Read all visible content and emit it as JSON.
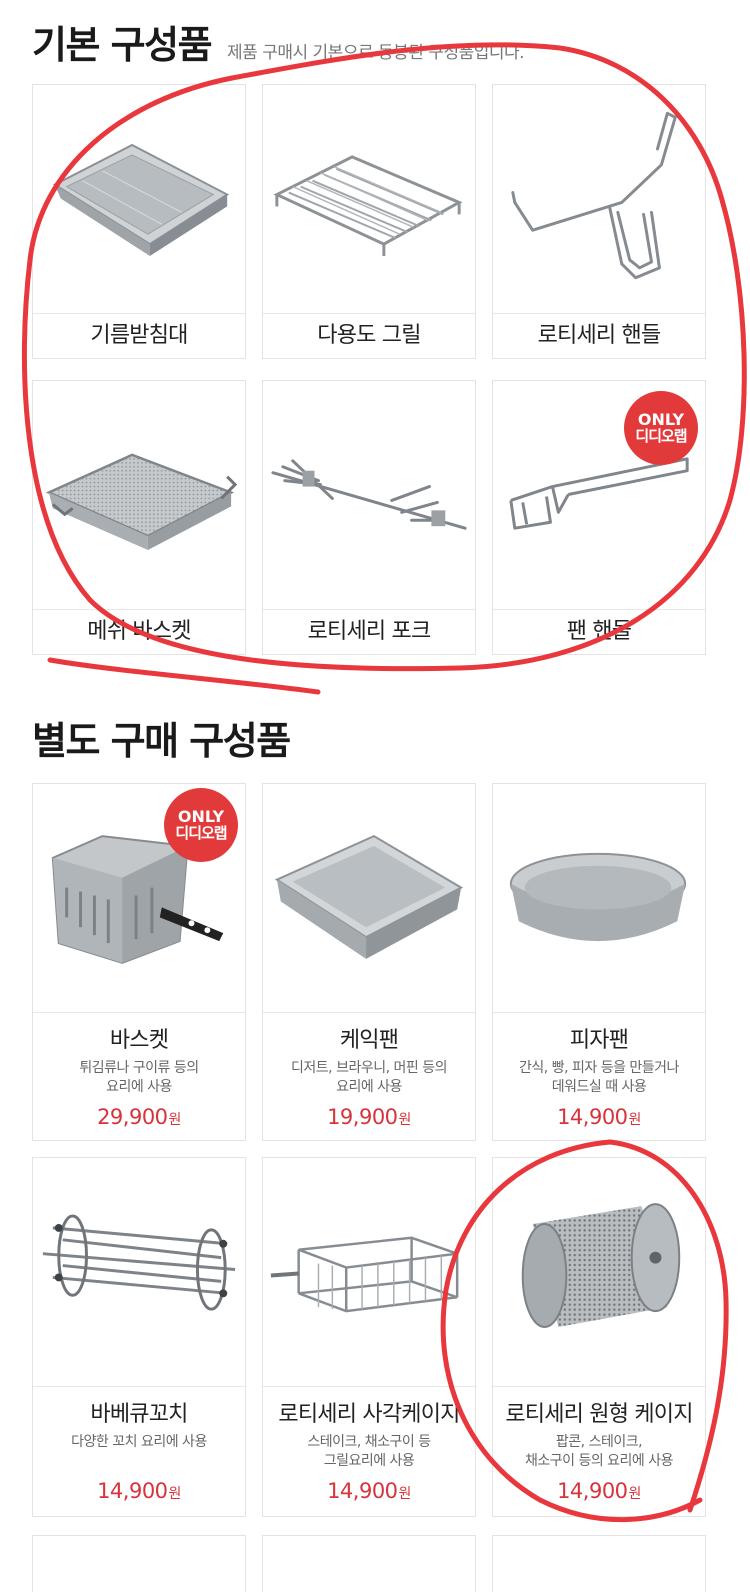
{
  "basic_section": {
    "title": "기본 구성품",
    "subtitle": "제품 구매시 기본으로 동봉된 구성품입니다.",
    "items": [
      {
        "label": "기름받침대",
        "icon": "drip-tray-icon"
      },
      {
        "label": "다용도 그릴",
        "icon": "wire-grill-icon"
      },
      {
        "label": "로티세리 핸들",
        "icon": "rotisserie-handle-icon"
      },
      {
        "label": "메쉬 바스켓",
        "icon": "mesh-basket-icon"
      },
      {
        "label": "로티세리 포크",
        "icon": "rotisserie-fork-icon"
      },
      {
        "label": "팬 핸들",
        "icon": "pan-handle-icon",
        "badge": {
          "line1": "ONLY",
          "line2": "디디오랩"
        }
      }
    ]
  },
  "option_section": {
    "title": "별도 구매 구성품",
    "items": [
      {
        "label": "바스켓",
        "desc1": "튀김류나 구이류 등의",
        "desc2": "요리에 사용",
        "price": "29,900",
        "unit": "원",
        "icon": "fry-basket-icon",
        "badge": {
          "line1": "ONLY",
          "line2": "디디오랩"
        }
      },
      {
        "label": "케익팬",
        "desc1": "디저트, 브라우니, 머핀 등의",
        "desc2": "요리에 사용",
        "price": "19,900",
        "unit": "원",
        "icon": "cake-pan-icon"
      },
      {
        "label": "피자팬",
        "desc1": "간식, 빵, 피자 등을 만들거나",
        "desc2": "데워드실 때 사용",
        "price": "14,900",
        "unit": "원",
        "icon": "pizza-pan-icon"
      },
      {
        "label": "바베큐꼬치",
        "desc1": "다양한 꼬치 요리에 사용",
        "desc2": "",
        "price": "14,900",
        "unit": "원",
        "icon": "skewer-rack-icon"
      },
      {
        "label": "로티세리 사각케이지",
        "desc1": "스테이크, 채소구이 등",
        "desc2": "그릴요리에 사용",
        "price": "14,900",
        "unit": "원",
        "icon": "square-cage-icon"
      },
      {
        "label": "로티세리 원형 케이지",
        "desc1": "팝콘, 스테이크,",
        "desc2": "채소구이 등의 요리에 사용",
        "price": "14,900",
        "unit": "원",
        "icon": "round-cage-icon"
      }
    ]
  },
  "colors": {
    "accent_red": "#d8333b",
    "badge_red": "#e23a3a",
    "scribble_red": "#e8383d"
  }
}
